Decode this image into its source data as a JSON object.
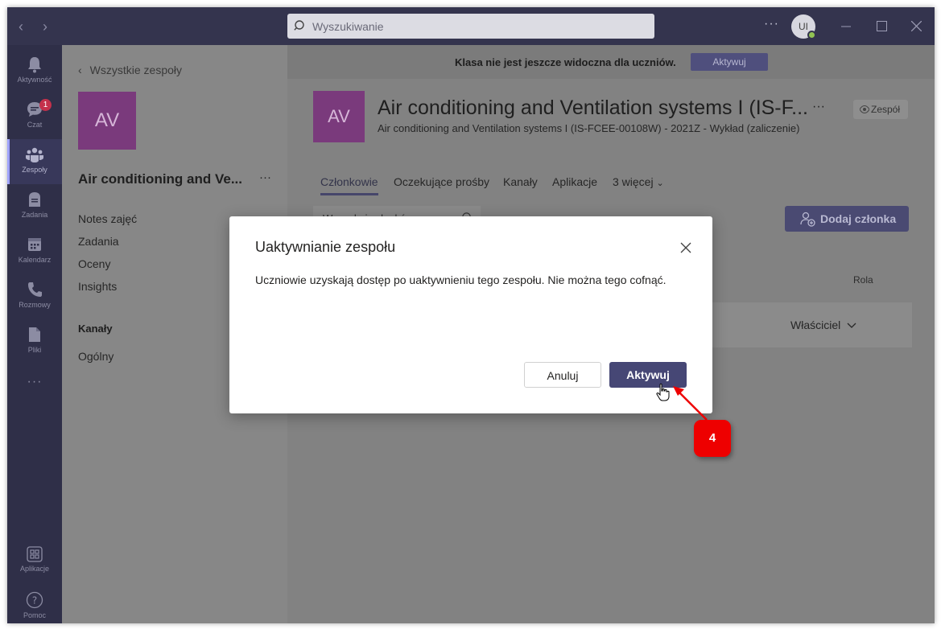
{
  "titlebar": {
    "search_placeholder": "Wyszukiwanie",
    "more": "···",
    "avatar_initials": "UI"
  },
  "rail": {
    "items": [
      {
        "label": "Aktywność",
        "icon": "bell-icon"
      },
      {
        "label": "Czat",
        "icon": "chat-icon",
        "badge": "1"
      },
      {
        "label": "Zespoły",
        "icon": "teams-icon",
        "active": true
      },
      {
        "label": "Zadania",
        "icon": "assignments-icon"
      },
      {
        "label": "Kalendarz",
        "icon": "calendar-icon"
      },
      {
        "label": "Rozmowy",
        "icon": "phone-icon"
      },
      {
        "label": "Pliki",
        "icon": "file-icon"
      }
    ],
    "more": "···",
    "apps_label": "Aplikacje",
    "help_label": "Pomoc"
  },
  "left_panel": {
    "back_label": "Wszystkie zespoły",
    "tile_initials": "AV",
    "team_name": "Air conditioning and Ve...",
    "team_more": "···",
    "items": [
      "Notes zajęć",
      "Zadania",
      "Oceny",
      "Insights"
    ],
    "channels_heading": "Kanały",
    "channels": [
      "Ogólny"
    ]
  },
  "main": {
    "banner_text": "Klasa nie jest jeszcze widoczna dla uczniów.",
    "banner_button": "Aktywuj",
    "tile_initials": "AV",
    "title": "Air conditioning and Ventilation systems I (IS-F...",
    "title_more": "···",
    "subtitle": "Air conditioning and Ventilation systems I (IS-FCEE-00108W) - 2021Z - Wykład (zaliczenie)",
    "team_pill": "Zespół",
    "tabs": [
      "Członkowie",
      "Oczekujące prośby",
      "Kanały",
      "Aplikacje",
      "3 więcej"
    ],
    "member_search_placeholder": "Wyszukaj członków",
    "add_member_button": "Dodaj członka",
    "column_role": "Rola",
    "owner_role": "Właściciel"
  },
  "dialog": {
    "title": "Uaktywnianie zespołu",
    "body": "Uczniowie uzyskają dostęp po uaktywnieniu tego zespołu. Nie można tego cofnąć.",
    "cancel": "Anuluj",
    "confirm": "Aktywuj"
  },
  "annotation": {
    "step_number": "4",
    "color": "#ee0000"
  },
  "colors": {
    "titlebar": "#34344e",
    "rail": "#2f2f48",
    "primary_button": "#464775",
    "team_tile": "#7a3a7c"
  }
}
